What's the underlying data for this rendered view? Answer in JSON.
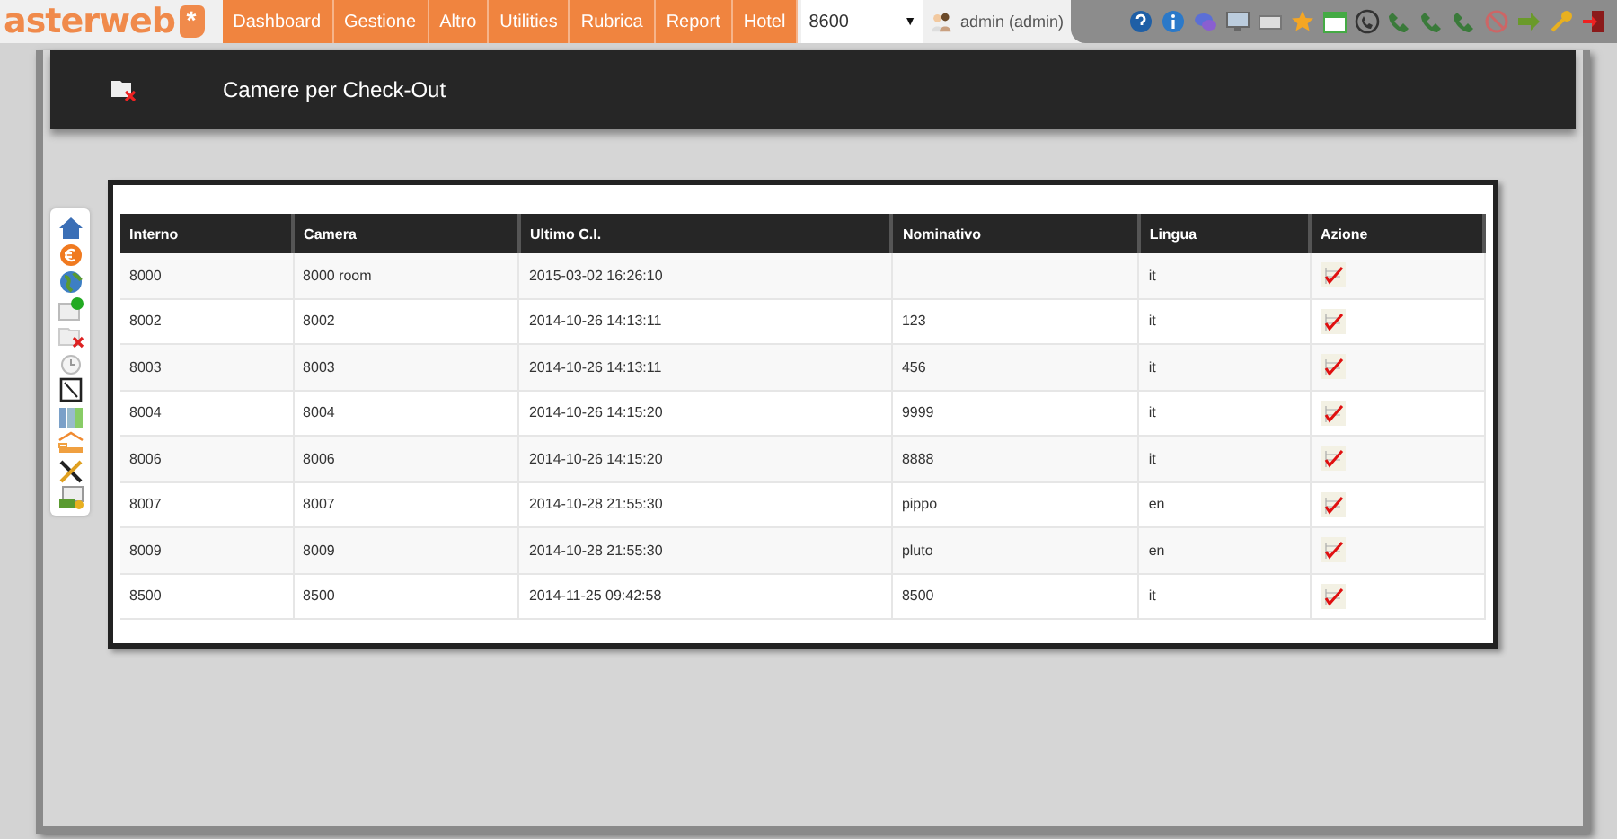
{
  "logo": {
    "text": "asterweb",
    "mark": "*"
  },
  "menu": [
    {
      "label": "Dashboard"
    },
    {
      "label": "Gestione"
    },
    {
      "label": "Altro"
    },
    {
      "label": "Utilities"
    },
    {
      "label": "Rubrica"
    },
    {
      "label": "Report"
    },
    {
      "label": "Hotel"
    }
  ],
  "extension_select": {
    "value": "8600",
    "caret": "▼"
  },
  "user": {
    "label": "admin (admin)"
  },
  "page": {
    "title": "Camere per Check-Out"
  },
  "table": {
    "columns": [
      "Interno",
      "Camera",
      "Ultimo C.I.",
      "Nominativo",
      "Lingua",
      "Azione"
    ],
    "rows": [
      {
        "interno": "8000",
        "camera": "8000 room",
        "ultimo": "2015-03-02 16:26:10",
        "nominativo": "",
        "lingua": "it"
      },
      {
        "interno": "8002",
        "camera": "8002",
        "ultimo": "2014-10-26 14:13:11",
        "nominativo": "123",
        "lingua": "it"
      },
      {
        "interno": "8003",
        "camera": "8003",
        "ultimo": "2014-10-26 14:13:11",
        "nominativo": "456",
        "lingua": "it"
      },
      {
        "interno": "8004",
        "camera": "8004",
        "ultimo": "2014-10-26 14:15:20",
        "nominativo": "9999",
        "lingua": "it"
      },
      {
        "interno": "8006",
        "camera": "8006",
        "ultimo": "2014-10-26 14:15:20",
        "nominativo": "8888",
        "lingua": "it"
      },
      {
        "interno": "8007",
        "camera": "8007",
        "ultimo": "2014-10-28 21:55:30",
        "nominativo": "pippo",
        "lingua": "en"
      },
      {
        "interno": "8009",
        "camera": "8009",
        "ultimo": "2014-10-28 21:55:30",
        "nominativo": "pluto",
        "lingua": "en"
      },
      {
        "interno": "8500",
        "camera": "8500",
        "ultimo": "2014-11-25 09:42:58",
        "nominativo": "8500",
        "lingua": "it"
      }
    ]
  }
}
